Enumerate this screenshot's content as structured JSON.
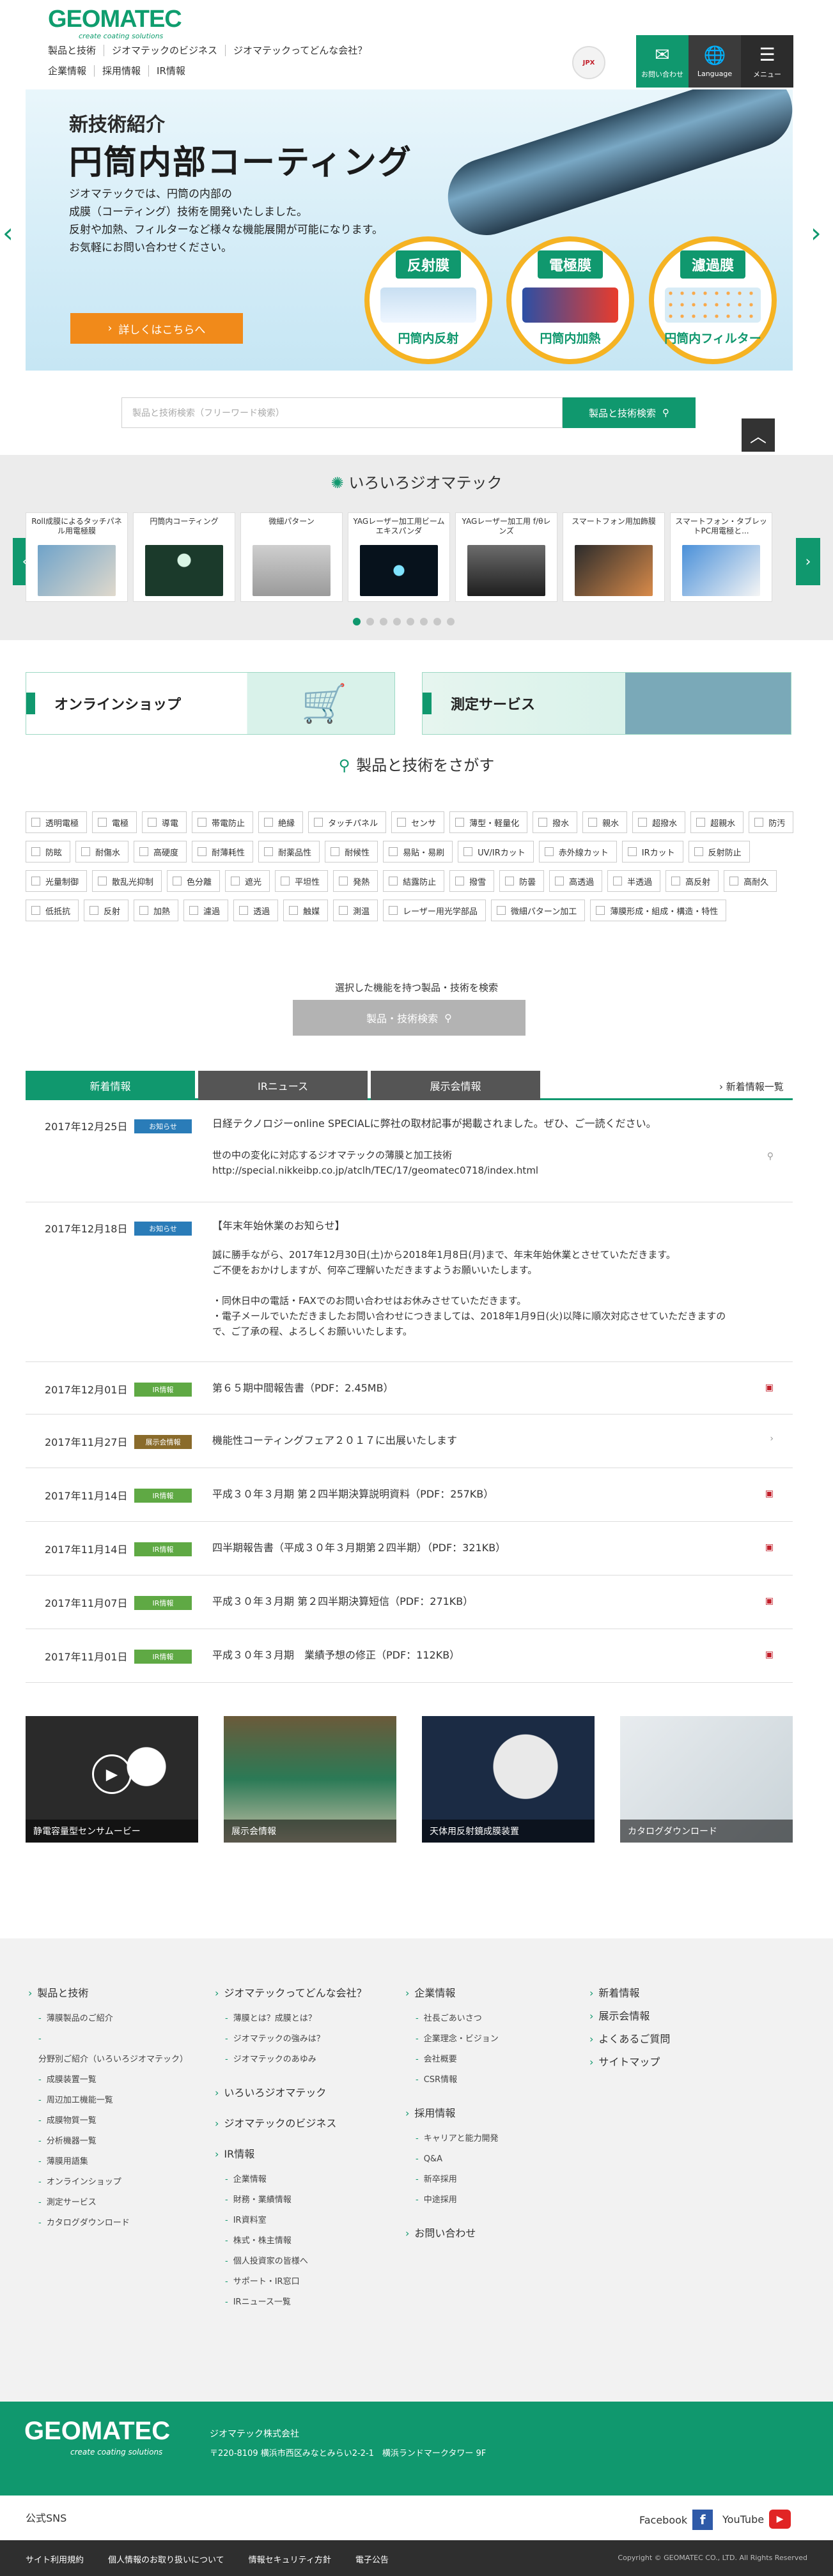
{
  "header": {
    "logo": "GEOMATEC",
    "logo_sub": "create coating solutions",
    "nav_primary": [
      "製品と技術",
      "ジオマテックのビジネス",
      "ジオマテックってどんな会社？"
    ],
    "nav_secondary": [
      "企業情報",
      "採用情報",
      "IR情報"
    ],
    "badge": "JPX",
    "contact_label": "お問い合わせ",
    "language_label": "Language",
    "menu_label": "メニュー"
  },
  "hero": {
    "subtitle": "新技術紹介",
    "title": "円筒内部コーティング",
    "description": [
      "ジオマテックでは、円筒の内部の",
      "成膜（コーティング）技術を開発いたしました。",
      "反射や加熱、フィルターなど様々な機能展開が可能になります。",
      "お気軽にお問い合わせください。"
    ],
    "cta": "詳しくはこちらへ",
    "circles": [
      {
        "tag": "反射膜",
        "caption": "円筒内反射"
      },
      {
        "tag": "電極膜",
        "caption": "円筒内加熱"
      },
      {
        "tag": "濾過膜",
        "caption": "円筒内フィルター"
      }
    ]
  },
  "search": {
    "placeholder": "製品と技術検索（フリーワード検索）",
    "button": "製品と技術検索"
  },
  "iroiro": {
    "title": "いろいろジオマテック",
    "items": [
      "Roll成膜によるタッチパネル用電極膜",
      "円筒内コーティング",
      "微細パターン",
      "YAGレーザー加工用ビームエキスパンダ",
      "YAGレーザー加工用 f/θレンズ",
      "スマートフォン用加飾膜",
      "スマートフォン・タブレットPC用電極と..."
    ],
    "dot_count": 8
  },
  "banners": {
    "shop": "オンラインショップ",
    "measure": "測定サービス"
  },
  "tech_search": {
    "title": "製品と技術をさがす",
    "tags": [
      "透明電極",
      "電極",
      "導電",
      "帯電防止",
      "絶縁",
      "タッチパネル",
      "センサ",
      "薄型・軽量化",
      "撥水",
      "親水",
      "超撥水",
      "超親水",
      "防汚",
      "防眩",
      "耐傷水",
      "高硬度",
      "耐薄耗性",
      "耐薬品性",
      "耐候性",
      "易貼・易刷",
      "UV/IRカット",
      "赤外線カット",
      "IRカット",
      "反射防止",
      "光量制御",
      "散乱光抑制",
      "色分離",
      "遮光",
      "平坦性",
      "発熱",
      "結露防止",
      "撥雪",
      "防曇",
      "高透過",
      "半透過",
      "高反射",
      "高耐久",
      "低抵抗",
      "反射",
      "加熱",
      "濾過",
      "透過",
      "触媒",
      "測温",
      "レーザー用光学部品",
      "微細パターン加工",
      "薄膜形成・組成・構造・特性"
    ],
    "selected_label": "選択した機能を持つ製品・技術を検索",
    "button": "製品・技術検索"
  },
  "news": {
    "tabs": [
      "新着情報",
      "IRニュース",
      "展示会情報"
    ],
    "all_link": "新着情報一覧",
    "items": [
      {
        "date": "2017年12月25日",
        "badge": "お知らせ",
        "title": "日経テクノロジーonline SPECIALに弊社の取材記事が掲載されました。ぜひ、ご一読ください。",
        "body": [
          "世の中の変化に対応するジオマテックの薄膜と加工技術",
          "http://special.nikkeibp.co.jp/atclh/TEC/17/geomatec0718/index.html"
        ]
      },
      {
        "date": "2017年12月18日",
        "badge": "お知らせ",
        "title": "【年末年始休業のお知らせ】",
        "body": [
          "誠に勝手ながら、2017年12月30日(土)から2018年1月8日(月)まで、年末年始休業とさせていただきます。",
          "ご不便をおかけしますが、何卒ご理解いただきますようお願いいたします。",
          "",
          "・同休日中の電話・FAXでのお問い合わせはお休みさせていただきます。",
          "・電子メールでいただきましたお問い合わせにつきましては、2018年1月9日(火)以降に順次対応させていただきますの",
          "で、ご了承の程、よろしくお願いいたします。"
        ]
      },
      {
        "date": "2017年12月01日",
        "badge": "IR情報",
        "title": "第６５期中間報告書（PDF：2.45MB）"
      },
      {
        "date": "2017年11月27日",
        "badge": "展示会情報",
        "title": "機能性コーティングフェア２０１７に出展いたします"
      },
      {
        "date": "2017年11月14日",
        "badge": "IR情報",
        "title": "平成３０年３月期 第２四半期決算説明資料（PDF：257KB）"
      },
      {
        "date": "2017年11月14日",
        "badge": "IR情報",
        "title": "四半期報告書（平成３０年３月期第２四半期）（PDF：321KB）"
      },
      {
        "date": "2017年11月07日",
        "badge": "IR情報",
        "title": "平成３０年３月期 第２四半期決算短信（PDF：271KB）"
      },
      {
        "date": "2017年11月01日",
        "badge": "IR情報",
        "title": "平成３０年３月期　業績予想の修正（PDF：112KB）"
      }
    ]
  },
  "tiles": [
    "静電容量型センサムービー",
    "展示会情報",
    "天体用反射鏡成膜装置",
    "カタログダウンロード"
  ],
  "footer_nav": {
    "col1": {
      "head": "製品と技術",
      "items": [
        "薄膜製品のご紹介",
        "分野別ご紹介（いろいろジオマテック）",
        "成膜装置一覧",
        "周辺加工機能一覧",
        "成膜物質一覧",
        "分析機器一覧",
        "薄膜用語集",
        "オンラインショップ",
        "測定サービス",
        "カタログダウンロード"
      ]
    },
    "col2": {
      "head": "ジオマテックってどんな会社？",
      "items": [
        "薄膜とは？成膜とは？",
        "ジオマテックの強みは？",
        "ジオマテックのあゆみ"
      ],
      "head2": "いろいろジオマテック",
      "head3": "ジオマテックのビジネス",
      "head4": "IR情報",
      "items4": [
        "企業情報",
        "財務・業績情報",
        "IR資料室",
        "株式・株主情報",
        "個人投資家の皆様へ",
        "サポート・IR窓口",
        "IRニュース一覧"
      ]
    },
    "col3": {
      "head": "企業情報",
      "items": [
        "社長ごあいさつ",
        "企業理念・ビジョン",
        "会社概要",
        "CSR情報"
      ],
      "head2": "採用情報",
      "items2": [
        "キャリアと能力開発",
        "Q&A",
        "新卒採用",
        "中途採用"
      ],
      "head3": "お問い合わせ"
    },
    "col4": {
      "items": [
        "新着情報",
        "展示会情報",
        "よくあるご質問",
        "サイトマップ"
      ]
    }
  },
  "footer_corp": {
    "logo": "GEOMATEC",
    "logo_sub": "create coating solutions",
    "name": "ジオマテック株式会社",
    "address": "〒220-8109 横浜市西区みなとみらい2-2-1　横浜ランドマークタワー 9F"
  },
  "sns": {
    "label": "公式SNS",
    "facebook": "Facebook",
    "youtube": "YouTube"
  },
  "footer_bottom": {
    "links": [
      "サイト利用規約",
      "個人情報のお取り扱いについて",
      "情報セキュリティ方針",
      "電子公告"
    ],
    "copyright": "Copyright © GEOMATEC CO., LTD. All Rights Reserved"
  },
  "colors": {
    "brand": "#10986e",
    "accent": "#f18a1a",
    "dark": "#2f2f2f"
  }
}
